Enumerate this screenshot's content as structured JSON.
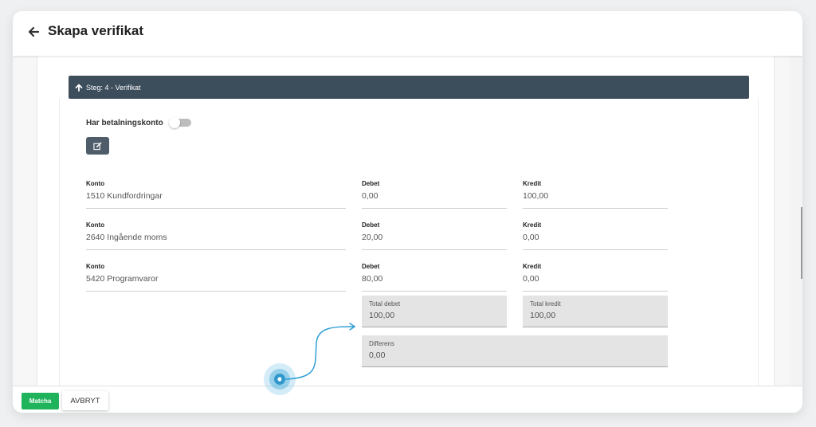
{
  "header": {
    "title": "Skapa verifikat",
    "back_icon": "arrow-left-icon"
  },
  "step": {
    "label": "Steg: 4 - Verifikat",
    "icon": "arrow-up-icon"
  },
  "payment_account": {
    "label": "Har betalningskonto",
    "enabled": false
  },
  "edit_icon": "edit-icon",
  "rows": [
    {
      "account_label": "Konto",
      "account": "1510 Kundfordringar",
      "debit_label": "Debet",
      "debit": "0,00",
      "credit_label": "Kredit",
      "credit": "100,00"
    },
    {
      "account_label": "Konto",
      "account": "2640 Ingående moms",
      "debit_label": "Debet",
      "debit": "20,00",
      "credit_label": "Kredit",
      "credit": "0,00"
    },
    {
      "account_label": "Konto",
      "account": "5420 Programvaror",
      "debit_label": "Debet",
      "debit": "80,00",
      "credit_label": "Kredit",
      "credit": "0,00"
    }
  ],
  "totals": {
    "debit_label": "Total debet",
    "debit": "100,00",
    "credit_label": "Total kredit",
    "credit": "100,00",
    "diff_label": "Differens",
    "diff": "0,00"
  },
  "footer": {
    "match_label": "Matcha",
    "cancel_label": "AVBRYT"
  },
  "colors": {
    "step_bar": "#3c4d5c",
    "match_button": "#1fb35b",
    "pointer": "#3aa7d9"
  }
}
